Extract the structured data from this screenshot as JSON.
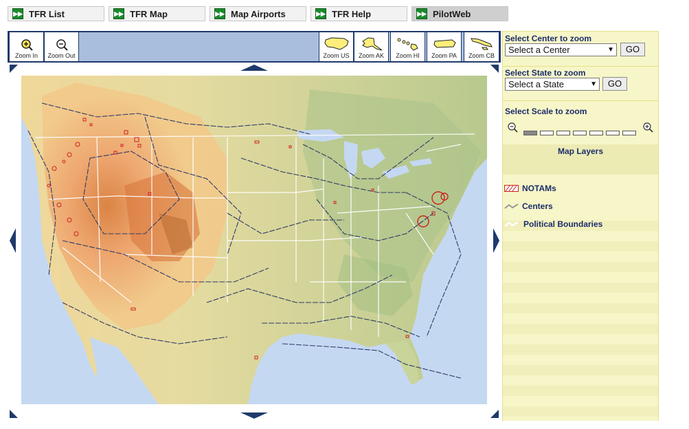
{
  "tabs": [
    {
      "label": "TFR List",
      "icon": "play-icon",
      "active": false
    },
    {
      "label": "TFR Map",
      "icon": "play-icon",
      "active": false
    },
    {
      "label": "Map Airports",
      "icon": "play-icon",
      "active": false
    },
    {
      "label": "TFR Help",
      "icon": "play-icon",
      "active": false
    },
    {
      "label": "PilotWeb",
      "icon": "play-icon",
      "active": true
    }
  ],
  "toolbar": {
    "zoom_in": "Zoom In",
    "zoom_out": "Zoom Out",
    "zoom_us": "Zoom US",
    "zoom_ak": "Zoom AK",
    "zoom_hi": "Zoom HI",
    "zoom_pa": "Zoom PA",
    "zoom_cb": "Zoom CB"
  },
  "sidebar": {
    "center": {
      "title": "Select Center to zoom",
      "selected": "Select a Center",
      "go": "GO"
    },
    "state": {
      "title": "Select State to zoom",
      "selected": "Select a State",
      "go": "GO"
    },
    "scale": {
      "title": "Select Scale to zoom",
      "segments": 7,
      "active_index": 0
    },
    "layers": {
      "title": "Map Layers",
      "items": [
        {
          "label": "NOTAMs",
          "icon": "notam-icon"
        },
        {
          "label": "Centers",
          "icon": "center-line-icon"
        },
        {
          "label": "Political Boundaries",
          "icon": "boundary-icon"
        }
      ]
    }
  },
  "colors": {
    "toolbar_bg": "#a9bedc",
    "toolbar_border": "#1f3a6b",
    "sidebar_bg": "#f7f6c8",
    "sidebar_text": "#1b2d6b",
    "tab_icon": "#1a8a2c",
    "notam": "#cc2222"
  }
}
